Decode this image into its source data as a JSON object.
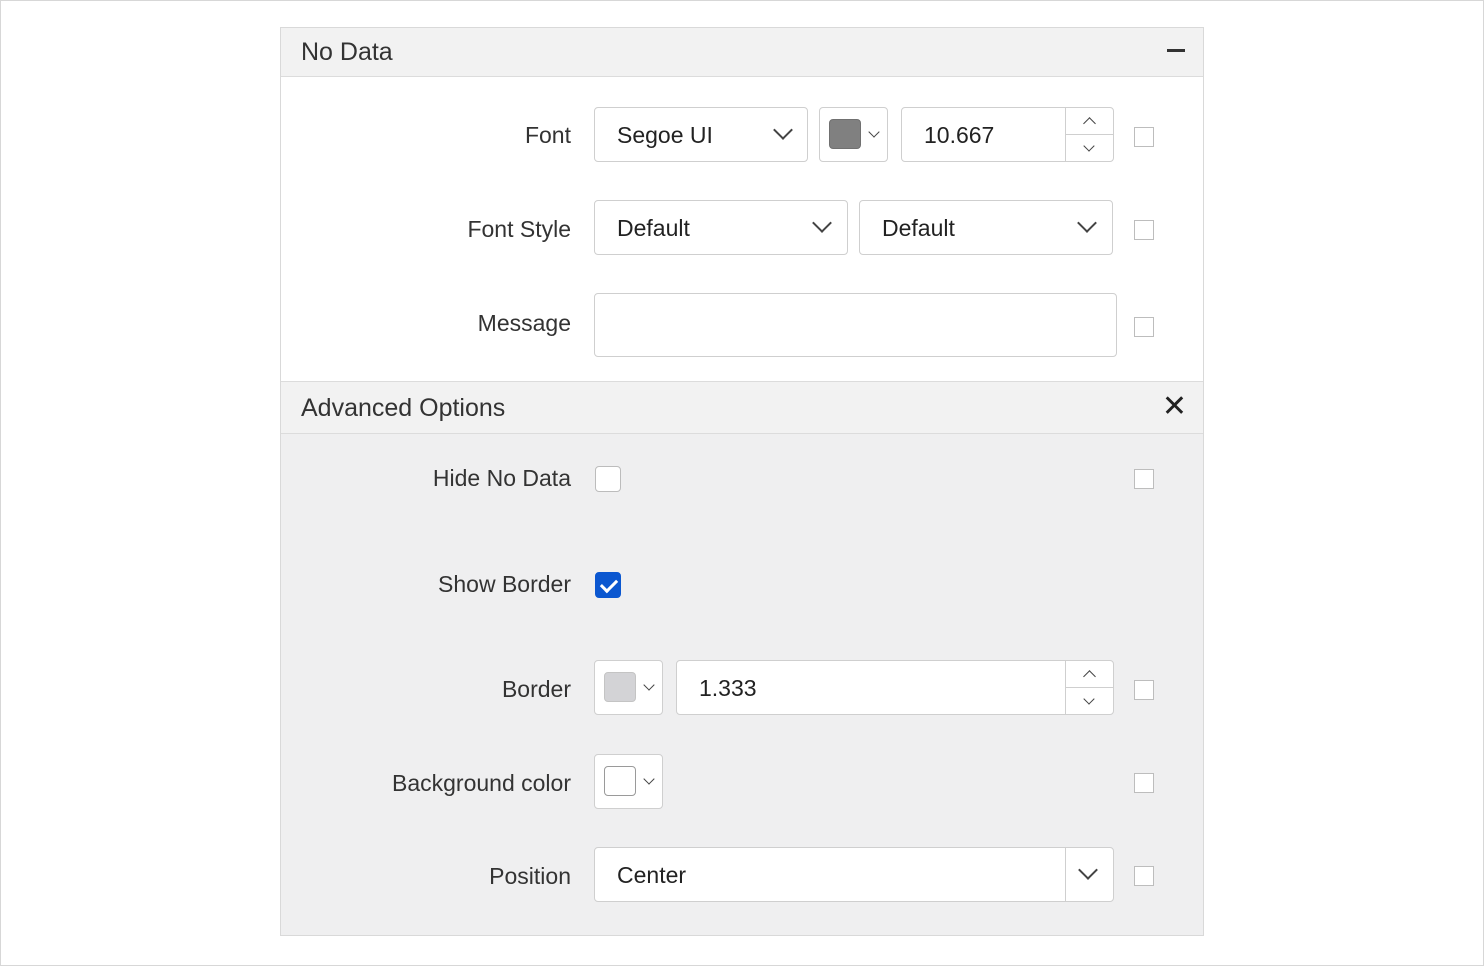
{
  "no_data_section": {
    "title": "No Data",
    "font": {
      "label": "Font",
      "family": "Segoe UI",
      "color": "#808080",
      "size": "10.667"
    },
    "font_style": {
      "label": "Font Style",
      "style": "Default",
      "weight": "Default"
    },
    "message": {
      "label": "Message",
      "value": ""
    }
  },
  "advanced_section": {
    "title": "Advanced Options",
    "hide_no_data": {
      "label": "Hide No Data",
      "checked": false
    },
    "show_border": {
      "label": "Show Border",
      "checked": true
    },
    "border": {
      "label": "Border",
      "color": "#d3d3d6",
      "width": "1.333"
    },
    "background_color": {
      "label": "Background color",
      "color": "#ffffff"
    },
    "position": {
      "label": "Position",
      "value": "Center"
    }
  },
  "colors": {
    "accent": "#0b57d0",
    "header_bg": "#f2f2f2",
    "advanced_bg": "#efeff0"
  },
  "icons": {
    "collapse": "minus-icon",
    "close": "close-icon",
    "dropdown": "chevron-down-icon",
    "spin_up": "chevron-up-icon",
    "spin_down": "chevron-down-icon"
  }
}
